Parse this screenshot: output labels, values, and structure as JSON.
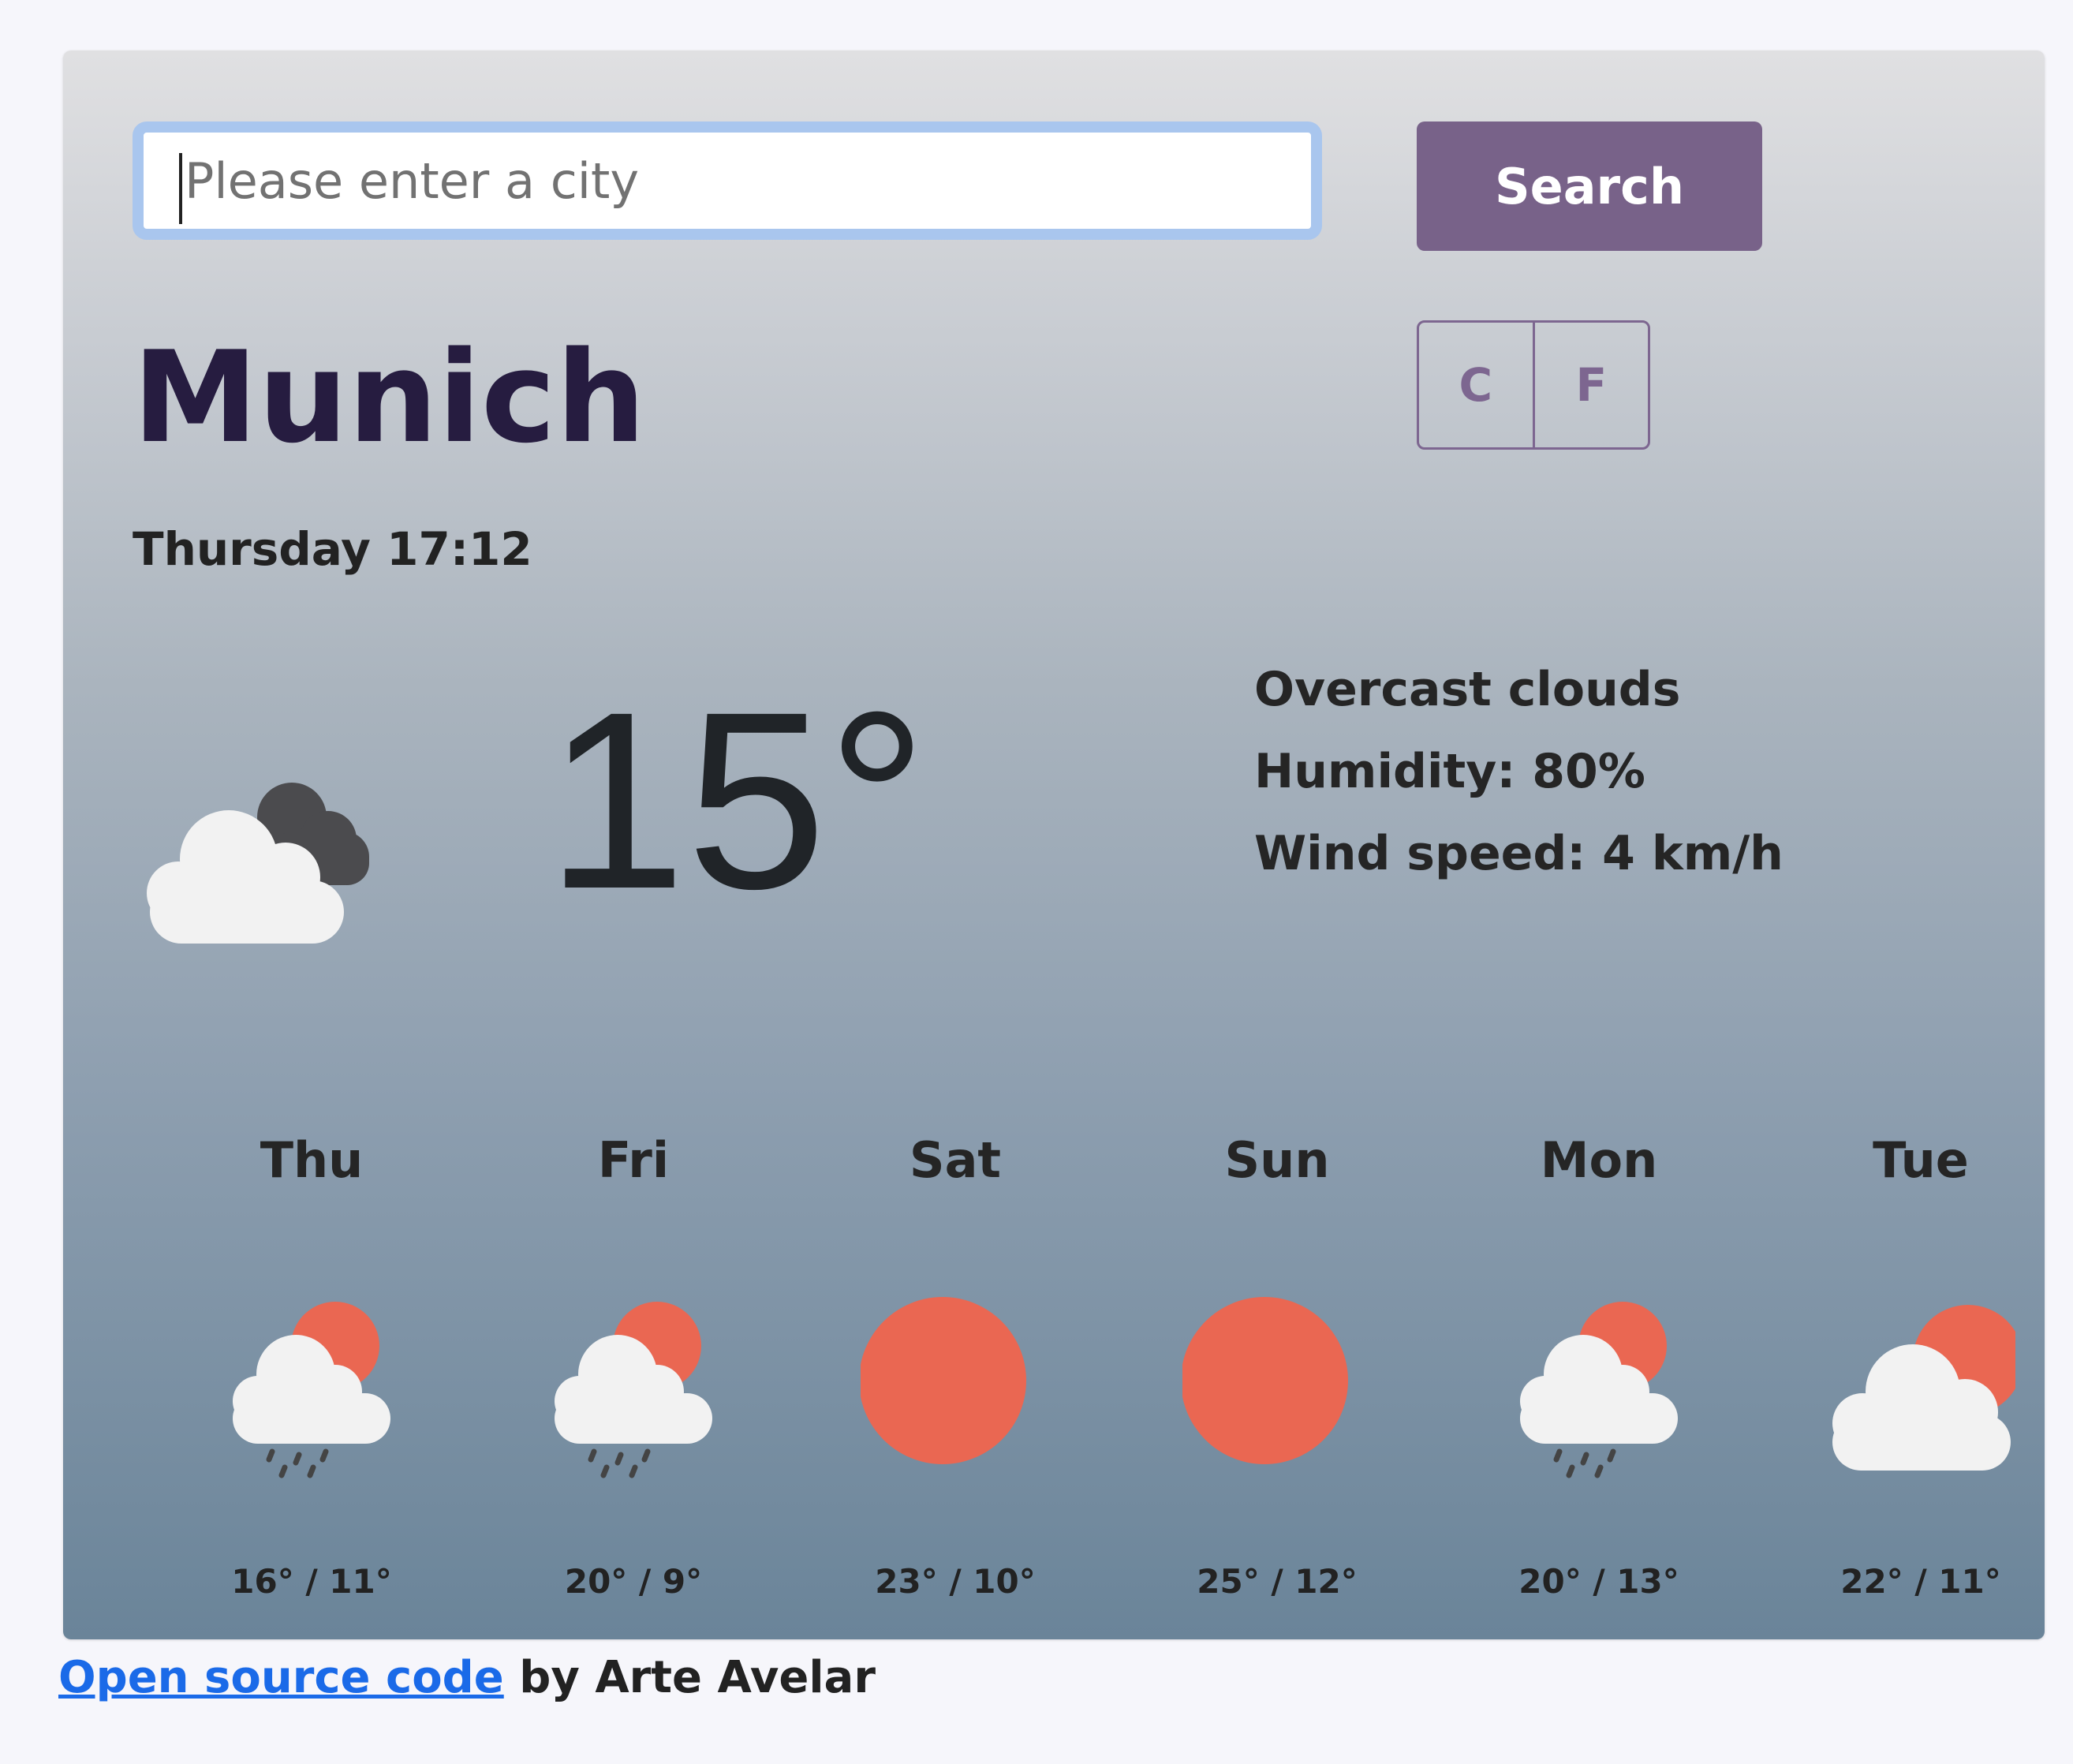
{
  "search": {
    "placeholder": "Please enter a city",
    "button_label": "Search"
  },
  "units": {
    "celsius_label": "C",
    "fahrenheit_label": "F"
  },
  "current": {
    "city": "Munich",
    "datetime": "Thursday 17:12",
    "temperature": "15°",
    "description": "Overcast clouds",
    "humidity": "Humidity: 80%",
    "wind": "Wind speed: 4 km/h",
    "icon": "overcast-clouds-icon"
  },
  "forecast": [
    {
      "day": "Thu",
      "temps": "16° / 11°",
      "icon": "sun-cloud-rain-icon"
    },
    {
      "day": "Fri",
      "temps": "20° / 9°",
      "icon": "sun-cloud-rain-icon"
    },
    {
      "day": "Sat",
      "temps": "23° / 10°",
      "icon": "sun-icon"
    },
    {
      "day": "Sun",
      "temps": "25° / 12°",
      "icon": "sun-icon"
    },
    {
      "day": "Mon",
      "temps": "20° / 13°",
      "icon": "sun-cloud-rain-icon"
    },
    {
      "day": "Tue",
      "temps": "22° / 11°",
      "icon": "sun-cloud-icon"
    }
  ],
  "footer": {
    "link_text": "Open source code",
    "byline": " by Arte Avelar"
  },
  "colors": {
    "accent": "#786289",
    "sun": "#ea6752",
    "city_text": "#261c40",
    "link": "#1a6ae8"
  }
}
